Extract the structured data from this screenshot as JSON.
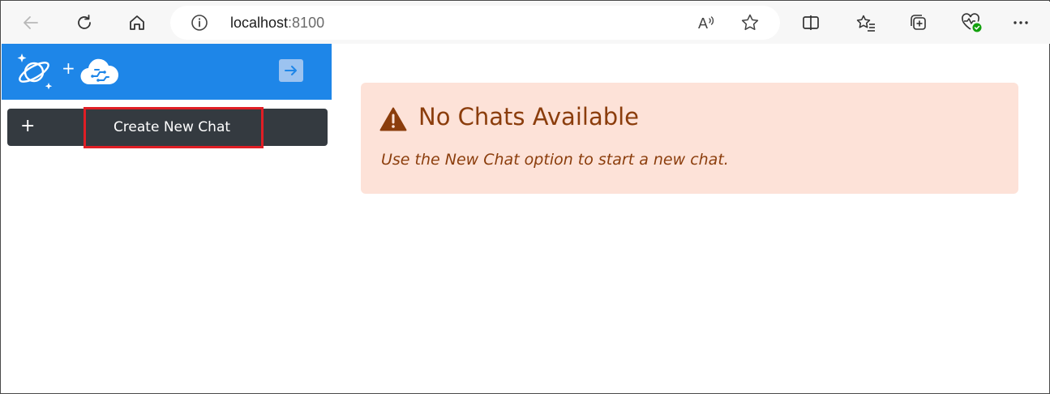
{
  "browser": {
    "url_host": "localhost",
    "url_port": ":8100",
    "icons": {
      "back": "back-arrow-icon",
      "refresh": "refresh-icon",
      "home": "home-icon",
      "info": "info-icon",
      "read_aloud": "read-aloud-icon",
      "favorite": "star-icon",
      "split_screen": "split-screen-icon",
      "favorites_list": "favorites-icon",
      "collections": "collections-icon",
      "health": "browser-essentials-icon",
      "more": "more-icon"
    }
  },
  "sidebar": {
    "header_color": "#1e86e8",
    "logo_plus": "+",
    "new_chat": {
      "plus": "+",
      "label": "Create New Chat"
    }
  },
  "alert": {
    "title": "No Chats Available",
    "message": "Use the New Chat option to start a new chat.",
    "background": "#fde2d8",
    "text_color": "#8b3d0c"
  },
  "annotation": {
    "highlight_color": "#e01e25"
  }
}
